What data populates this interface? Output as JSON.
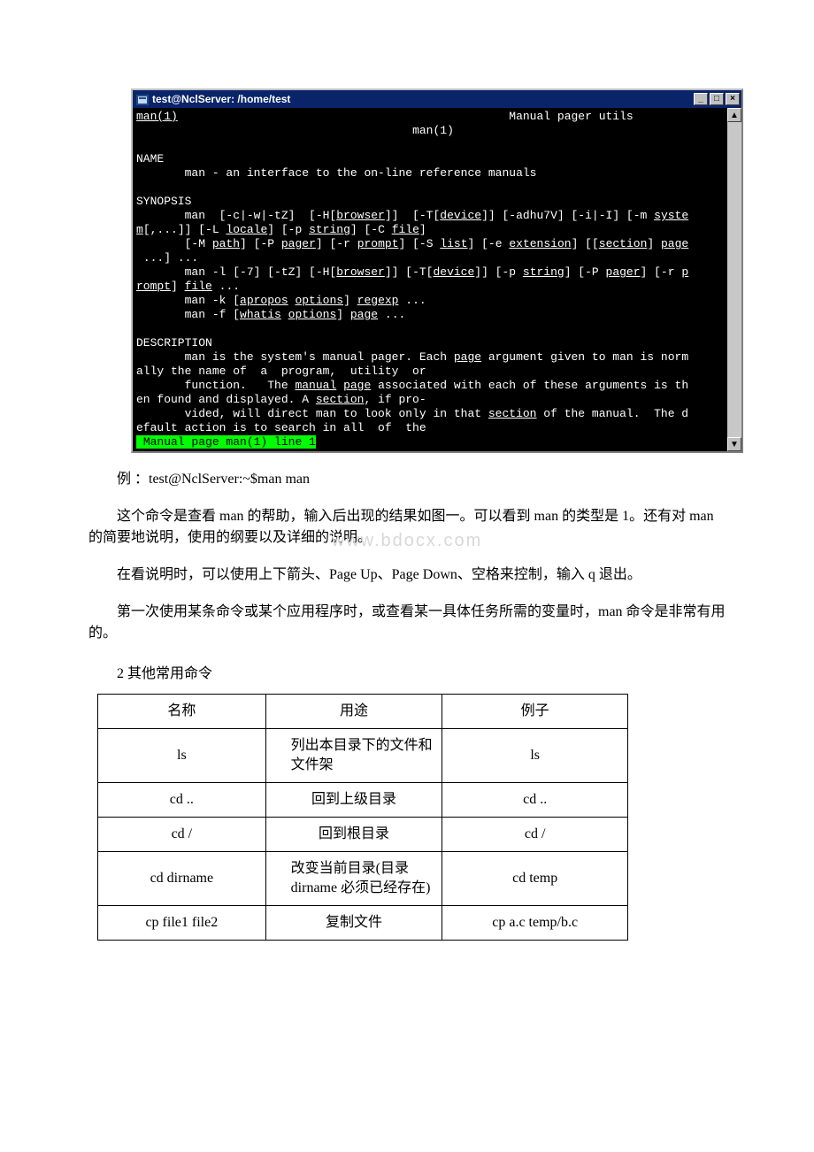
{
  "terminal": {
    "title": "test@NclServer: /home/test",
    "line1_left": "man(1)",
    "line1_right": "Manual pager utils",
    "line2_center": "man(1)",
    "hdr_name": "NAME",
    "name_line": "man - an interface to the on-line reference manuals",
    "hdr_syn": "SYNOPSIS",
    "syn_a1": "man  [-c|-w|-tZ]  [-H[",
    "syn_a2": "browser",
    "syn_a3": "]]  [-T[",
    "syn_a4": "device",
    "syn_a5": "]] [-adhu7V] [-i|-I] [-m ",
    "syn_a6": "syste",
    "syn_b1": "m",
    "syn_b2": "[,...]] [-L ",
    "syn_b3": "locale",
    "syn_b4": "] [-p ",
    "syn_b5": "string",
    "syn_b6": "] [-C ",
    "syn_b7": "file",
    "syn_b8": "]",
    "syn_c1": "[-M ",
    "syn_c2": "path",
    "syn_c3": "] [-P ",
    "syn_c4": "pager",
    "syn_c5": "] [-r ",
    "syn_c6": "prompt",
    "syn_c7": "] [-S ",
    "syn_c8": "list",
    "syn_c9": "] [-e ",
    "syn_c10": "extension",
    "syn_c11": "] [[",
    "syn_c12": "section",
    "syn_c13": "] ",
    "syn_c14": "page",
    "syn_d1": " ...] ...",
    "syn_e1": "man -l [-7] [-tZ] [-H[",
    "syn_e2": "browser",
    "syn_e3": "]] [-T[",
    "syn_e4": "device",
    "syn_e5": "]] [-p ",
    "syn_e6": "string",
    "syn_e7": "] [-P ",
    "syn_e8": "pager",
    "syn_e9": "] [-r ",
    "syn_e10": "p",
    "syn_f1": "rompt",
    "syn_f2": "] ",
    "syn_f3": "file",
    "syn_f4": " ...",
    "syn_g1": "man -k [",
    "syn_g2": "apropos",
    "syn_g3": " ",
    "syn_g4": "options",
    "syn_g5": "] ",
    "syn_g6": "regexp",
    "syn_g7": " ...",
    "syn_h1": "man -f [",
    "syn_h2": "whatis",
    "syn_h3": " ",
    "syn_h4": "options",
    "syn_h5": "] ",
    "syn_h6": "page",
    "syn_h7": " ...",
    "hdr_desc": "DESCRIPTION",
    "desc_a1": "man is the system's manual pager. Each ",
    "desc_a2": "page",
    "desc_a3": " argument given to man is norm",
    "desc_b1": "ally the name of  a  program,  utility  or",
    "desc_c1": "function.   The ",
    "desc_c2": "manual",
    "desc_c3": " ",
    "desc_c4": "page",
    "desc_c5": " associated with each of these arguments is th",
    "desc_d1": "en found and displayed. A ",
    "desc_d2": "section",
    "desc_d3": ", if pro-",
    "desc_e1": "vided, will direct man to look only in that ",
    "desc_e2": "section",
    "desc_e3": " of the manual.  The d",
    "desc_f1": "efault action is to search in all  of  the",
    "status": " Manual page man(1) line 1"
  },
  "doc": {
    "example": "例 ：test@NclServer:~$man man",
    "p1": "这个命令是查看 man 的帮助，输入后出现的结果如图一。可以看到 man 的类型是 1。还有对 man 的简要地说明，使用的纲要以及详细的说明。",
    "p2": "在看说明时，可以使用上下箭头、Page Up、Page Down、空格来控制，输入 q 退出。",
    "p3": "第一次使用某条命令或某个应用程序时，或查看某一具体任务所需的变量时，man 命令是非常有用的。",
    "sec2": "2 其他常用命令",
    "watermark": "www.bdocx.com"
  },
  "table": {
    "h1": "名称",
    "h2": "用途",
    "h3": "例子",
    "r1c1": "ls",
    "r1c2": "列出本目录下的文件和文件架",
    "r1c3": "ls",
    "r2c1": "cd ..",
    "r2c2": "回到上级目录",
    "r2c3": "cd ..",
    "r3c1": "cd /",
    "r3c2": "回到根目录",
    "r3c3": "cd /",
    "r4c1": "cd dirname",
    "r4c2": "改变当前目录(目录 dirname 必须已经存在)",
    "r4c3": "cd temp",
    "r5c1": "cp file1 file2",
    "r5c2": "复制文件",
    "r5c3": "cp a.c temp/b.c"
  }
}
